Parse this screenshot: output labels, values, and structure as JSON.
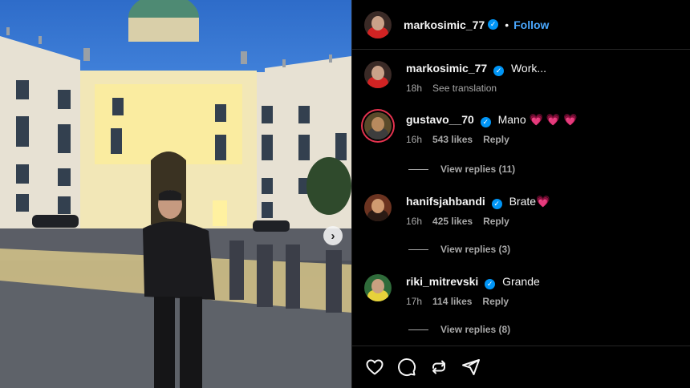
{
  "post": {
    "author": "markosimic_77",
    "follow_label": "Follow",
    "separator": "•",
    "next_photo_icon": "chevron-right-icon"
  },
  "comments": [
    {
      "username": "markosimic_77",
      "verified": true,
      "text": "Work...",
      "time": "18h",
      "action": "See translation"
    },
    {
      "username": "gustavo__70",
      "verified": true,
      "text": "Mano",
      "hearts": "💗 💗 💗",
      "time": "16h",
      "likes": "543 likes",
      "reply": "Reply",
      "view_replies": "View replies (11)"
    },
    {
      "username": "hanifsjahbandi",
      "verified": true,
      "text": "Brate",
      "hearts": "💗",
      "time": "16h",
      "likes": "425 likes",
      "reply": "Reply",
      "view_replies": "View replies (3)"
    },
    {
      "username": "riki_mitrevski",
      "verified": true,
      "text": "Grande",
      "time": "17h",
      "likes": "114 likes",
      "reply": "Reply",
      "view_replies": "View replies (8)"
    }
  ],
  "actions": [
    "heart-icon",
    "comment-icon",
    "repost-icon",
    "share-icon"
  ],
  "colors": {
    "accent": "#0095f6",
    "follow": "#4aa8ff",
    "background": "#000000"
  }
}
